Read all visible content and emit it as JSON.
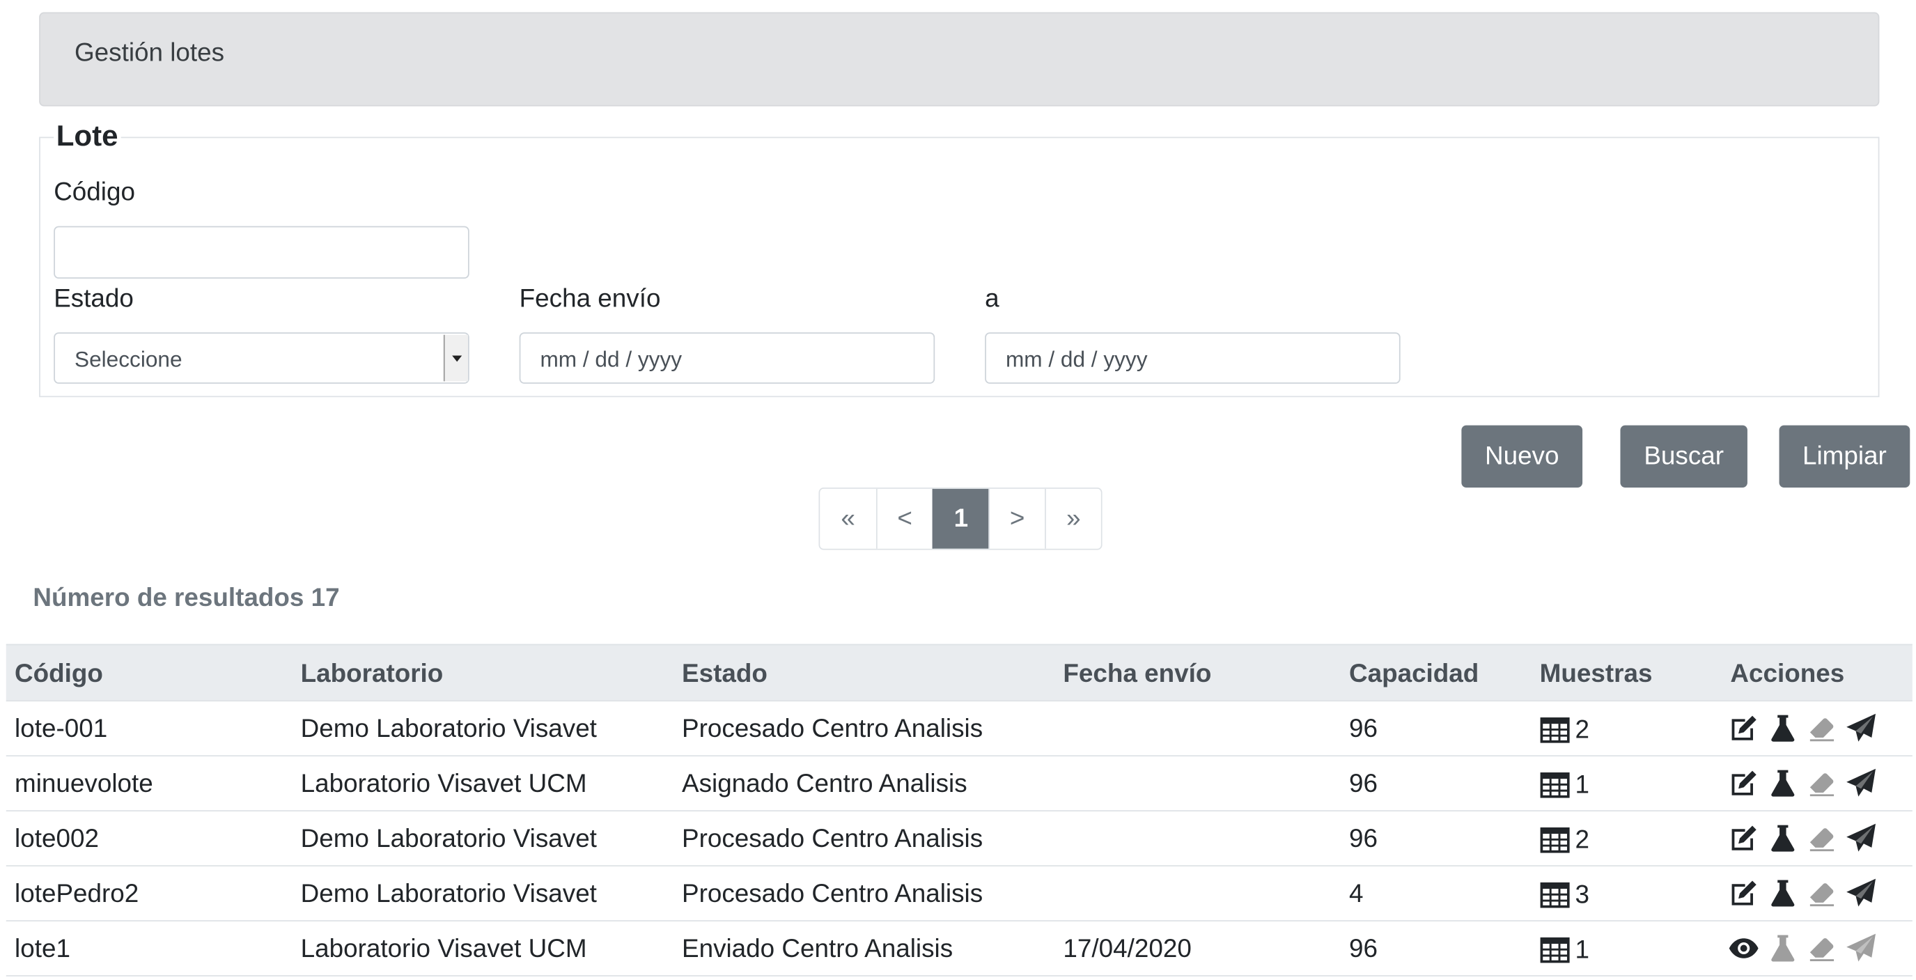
{
  "breadcrumb": {
    "title": "Gestión lotes"
  },
  "filter": {
    "legend": "Lote",
    "codigo": {
      "label": "Código",
      "value": ""
    },
    "estado": {
      "label": "Estado",
      "value": "Seleccione"
    },
    "fecha_envio": {
      "label": "Fecha envío",
      "placeholder": "mm / dd / yyyy"
    },
    "fecha_hasta": {
      "label": "a",
      "placeholder": "mm / dd / yyyy"
    }
  },
  "actions": {
    "nuevo": "Nuevo",
    "buscar": "Buscar",
    "limpiar": "Limpiar"
  },
  "pager": {
    "first": "«",
    "prev": "<",
    "current": "1",
    "next": ">",
    "last": "»"
  },
  "results": {
    "text": "Número de resultados 17"
  },
  "table": {
    "headers": [
      "Código",
      "Laboratorio",
      "Estado",
      "Fecha envío",
      "Capacidad",
      "Muestras",
      "Acciones"
    ],
    "rows": [
      {
        "codigo": "lote-001",
        "laboratorio": "Demo Laboratorio Visavet",
        "estado": "Procesado Centro Analisis",
        "fecha": "",
        "capacidad": "96",
        "muestras": "2",
        "first_action": "edit-icon",
        "enabled": true
      },
      {
        "codigo": "minuevolote",
        "laboratorio": "Laboratorio Visavet UCM",
        "estado": "Asignado Centro Analisis",
        "fecha": "",
        "capacidad": "96",
        "muestras": "1",
        "first_action": "edit-icon",
        "enabled": true
      },
      {
        "codigo": "lote002",
        "laboratorio": "Demo Laboratorio Visavet",
        "estado": "Procesado Centro Analisis",
        "fecha": "",
        "capacidad": "96",
        "muestras": "2",
        "first_action": "edit-icon",
        "enabled": true
      },
      {
        "codigo": "lotePedro2",
        "laboratorio": "Demo Laboratorio Visavet",
        "estado": "Procesado Centro Analisis",
        "fecha": "",
        "capacidad": "4",
        "muestras": "3",
        "first_action": "edit-icon",
        "enabled": true
      },
      {
        "codigo": "lote1",
        "laboratorio": "Laboratorio Visavet UCM",
        "estado": "Enviado Centro Analisis",
        "fecha": "17/04/2020",
        "capacidad": "96",
        "muestras": "1",
        "first_action": "eye-icon",
        "enabled": false
      }
    ]
  },
  "colors": {
    "button": "#6c757d",
    "header_bg": "#e9ecef",
    "breadcrumb_bg": "#e2e3e5",
    "disabled_icon": "#9e9e9e"
  }
}
